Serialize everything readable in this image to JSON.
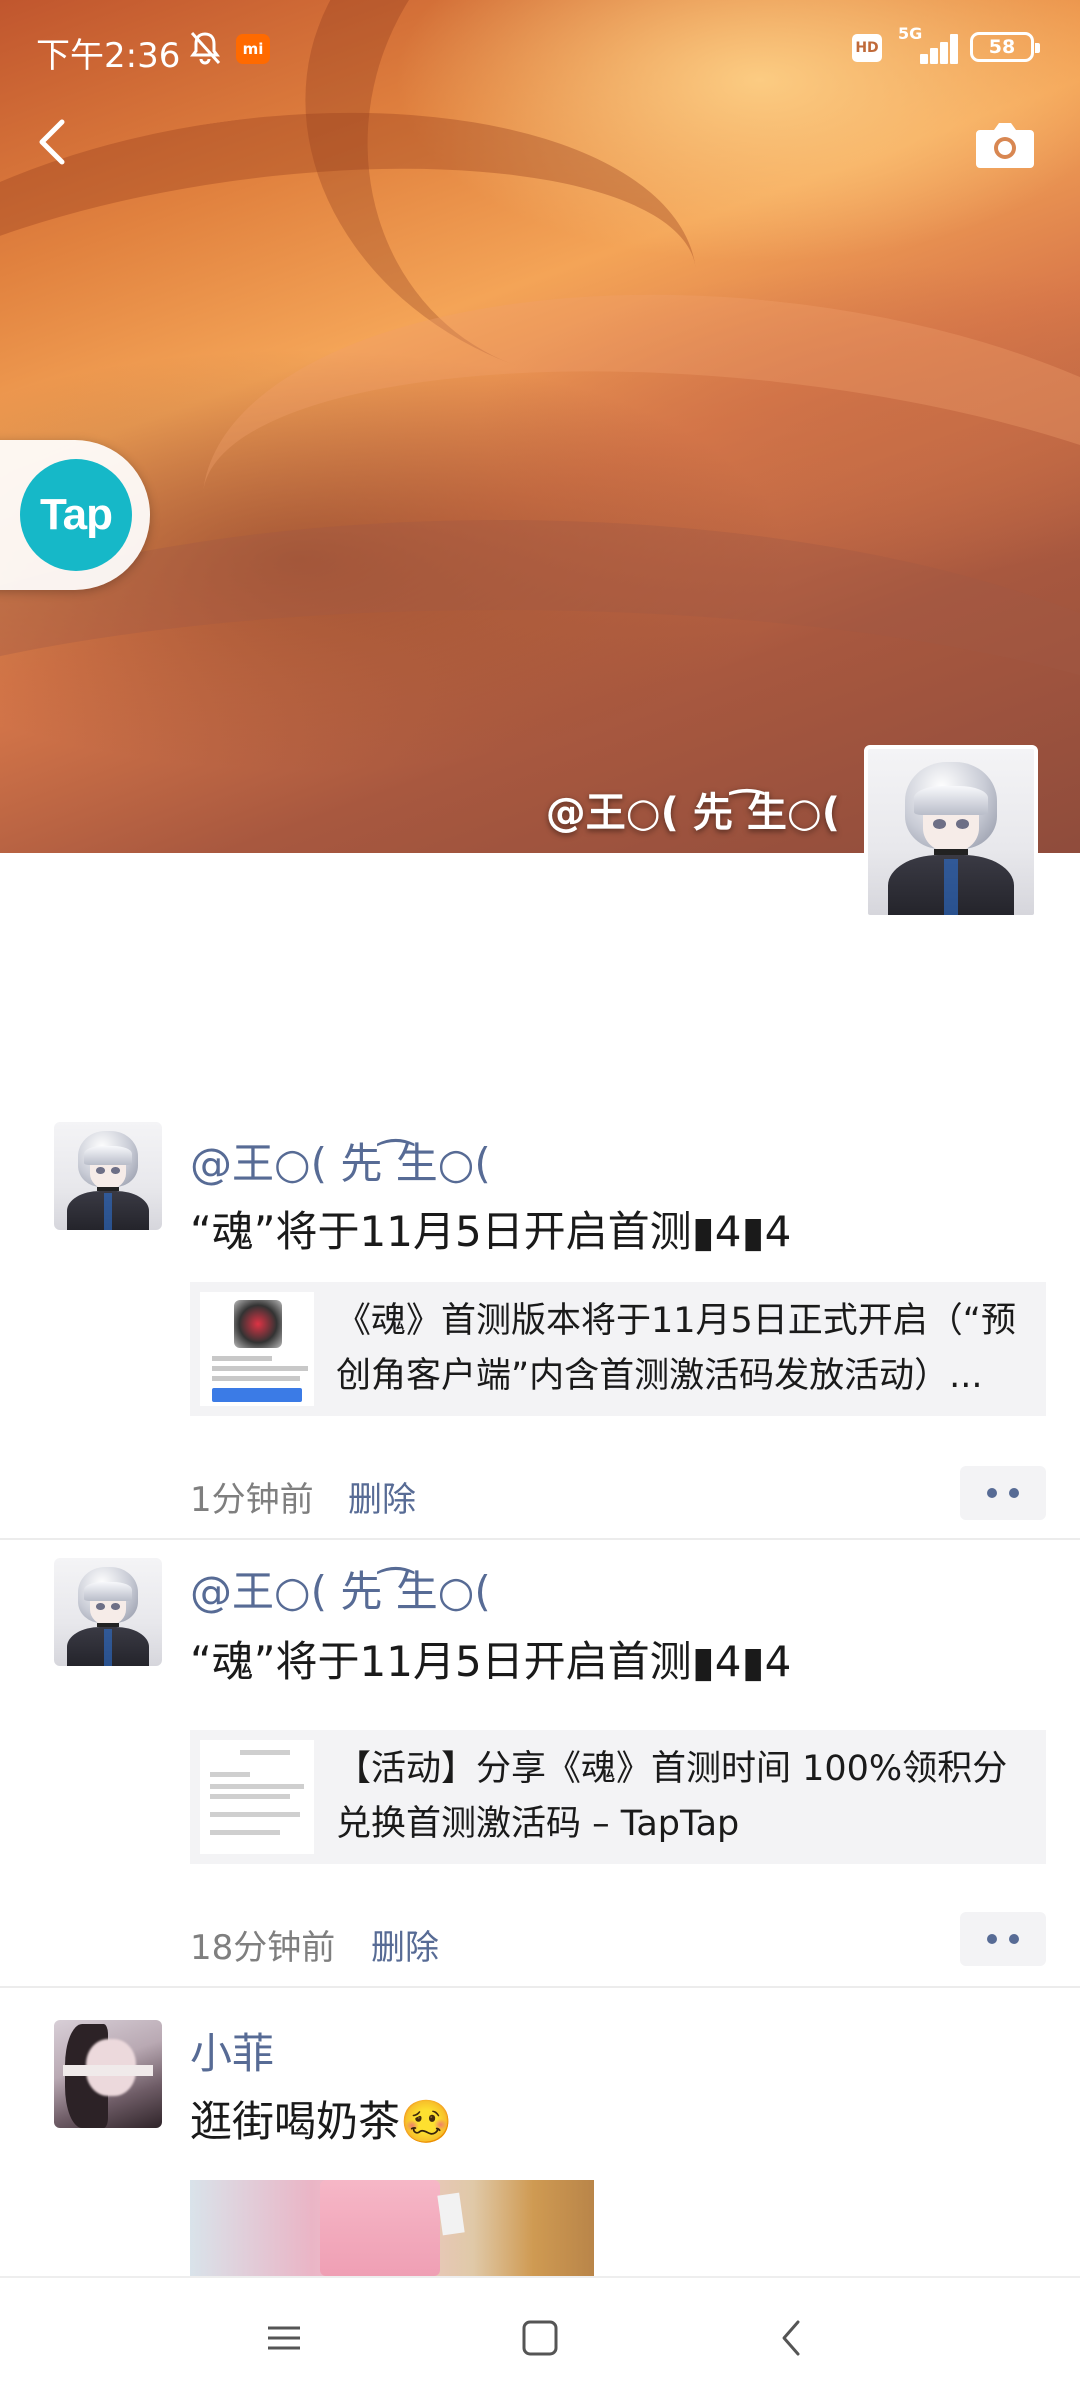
{
  "status_bar": {
    "time": "下午2:36",
    "mi_label": "mi",
    "hd_label": "HD",
    "network": "5G",
    "battery": "58"
  },
  "profile": {
    "cover_name": "@王○( 先 ͡生○(",
    "floating_app_label": "Tap"
  },
  "posts": [
    {
      "author": "@王○( 先 ͡生○(",
      "text": "“魂”将于11月5日开启首测▮4▮4",
      "link_title": "《魂》首测版本将于11月5日正式开启（“预创角客户端”内含首测激活码发放活动）...",
      "time": "1分钟前",
      "delete_label": "删除"
    },
    {
      "author": "@王○( 先 ͡生○(",
      "text": "“魂”将于11月5日开启首测▮4▮4",
      "link_title": "【活动】分享《魂》首测时间 100%领积分兑换首测激活码 – TapTap",
      "time": "18分钟前",
      "delete_label": "删除"
    },
    {
      "author": "小菲",
      "text": "逛街喝奶茶🥴"
    }
  ],
  "colors": {
    "link_blue": "#576b95",
    "tap_teal": "#16b8c8",
    "card_bg": "#f3f3f5"
  },
  "icons": {
    "back": "chevron-left-icon",
    "camera": "camera-icon",
    "more": "more-dots-icon",
    "nav_menu": "menu-icon",
    "nav_home": "home-square-icon",
    "nav_back": "back-triangle-icon"
  }
}
